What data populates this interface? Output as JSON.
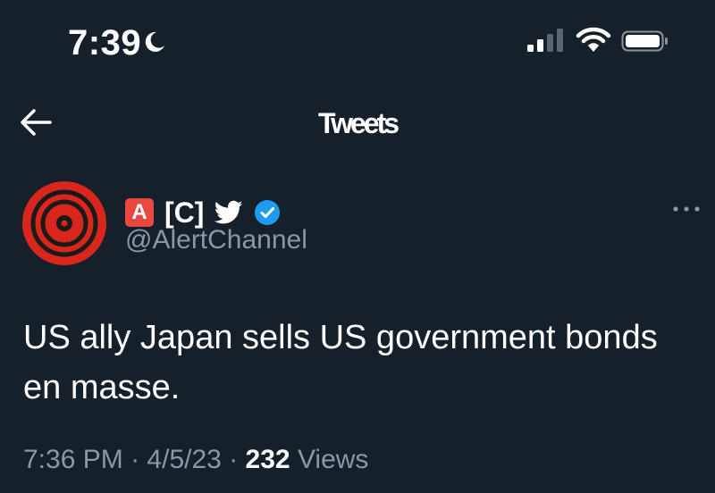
{
  "status_bar": {
    "time": "7:39",
    "icons": [
      "moon-icon",
      "cellular-signal-icon",
      "wifi-icon",
      "battery-icon"
    ]
  },
  "nav": {
    "title": "Tweets",
    "back_icon": "back-arrow-icon"
  },
  "tweet": {
    "author": {
      "emoji_badge": "A",
      "display_name": "[C]",
      "handle": "@AlertChannel",
      "icons": [
        "twitter-bird-icon",
        "verified-badge-icon"
      ]
    },
    "more_icon": "more-options-icon",
    "text": "US ally Japan sells US government bonds en masse.",
    "time": "7:36 PM",
    "separator": "·",
    "date": "4/5/23",
    "views_count": "232",
    "views_label": "Views"
  },
  "colors": {
    "background": "#15202b",
    "text": "#ffffff",
    "secondary_text": "#8899a6",
    "verified_blue": "#1d9bf0",
    "avatar_red": "#d9261c",
    "badge_red": "#e8483f"
  }
}
